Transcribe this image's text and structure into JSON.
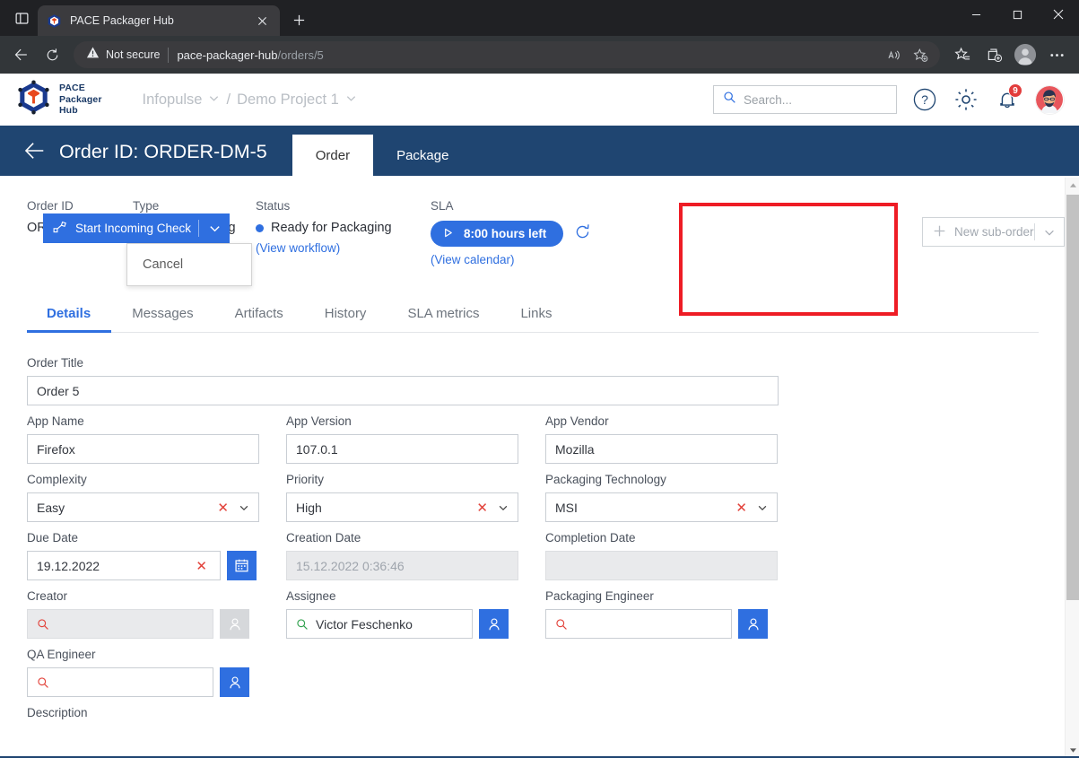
{
  "browser": {
    "tab": {
      "title": "PACE Packager Hub",
      "favicon": "pace-logo-icon",
      "close_icon": "close-icon"
    },
    "new_tab_icon": "plus-icon",
    "tab_search_icon": "tab-list-icon",
    "nav": {
      "back_icon": "back-arrow-icon",
      "reload_icon": "reload-icon"
    },
    "security": {
      "icon": "warning-icon",
      "label": "Not secure"
    },
    "url": {
      "host": "pace-packager-hub",
      "path": "/orders/5"
    },
    "omnibox_icons": [
      "read-aloud-icon",
      "add-favorite-icon"
    ],
    "toolbar_icons": [
      "favorites-icon",
      "collections-icon",
      "profile-icon",
      "settings-more-icon"
    ],
    "window_controls": {
      "minimize": "minimize-icon",
      "maximize": "maximize-icon",
      "close": "close-icon"
    }
  },
  "app": {
    "logo": {
      "icon": "pace-cube-logo",
      "line1": "PACE",
      "line2": "Packager",
      "line3": "Hub"
    },
    "breadcrumb": {
      "org": "Infopulse",
      "separator": "/",
      "project": "Demo Project 1",
      "caret_icon": "chevron-down-icon"
    },
    "search": {
      "placeholder": "Search...",
      "icon": "search-icon"
    },
    "help_icon": "help-circle-icon",
    "settings_icon": "gear-icon",
    "notifications": {
      "icon": "bell-icon",
      "count": "9"
    },
    "avatar": "user-avatar"
  },
  "order_bar": {
    "back_icon": "back-arrow-icon",
    "title": "Order ID: ORDER-DM-5",
    "tabs": [
      {
        "label": "Order",
        "active": true
      },
      {
        "label": "Package",
        "active": false
      }
    ]
  },
  "summary": {
    "order_id": {
      "label": "Order ID",
      "value": "ORDER-DM-5"
    },
    "type": {
      "label": "Type",
      "value": "App Packaging",
      "dot_color": "#2f6fe0"
    },
    "status": {
      "label": "Status",
      "value": "Ready for Packaging",
      "dot_color": "#2f6fe0",
      "link": "(View workflow)"
    },
    "sla": {
      "label": "SLA",
      "value": "8:00 hours left",
      "play_icon": "play-icon",
      "refresh_icon": "refresh-icon",
      "link": "(View calendar)"
    }
  },
  "actions": {
    "primary": {
      "label": "Start Incoming Check",
      "icon": "workflow-icon",
      "caret_icon": "chevron-down-icon",
      "color": "#2f6fe0"
    },
    "menu": [
      {
        "label": "Cancel"
      }
    ],
    "secondary": {
      "label": "New sub-order",
      "icon": "plus-icon",
      "caret_icon": "chevron-down-icon",
      "disabled": true
    },
    "highlight_color": "#ee1c25"
  },
  "detail_tabs": [
    {
      "label": "Details",
      "active": true
    },
    {
      "label": "Messages",
      "active": false
    },
    {
      "label": "Artifacts",
      "active": false
    },
    {
      "label": "History",
      "active": false
    },
    {
      "label": "SLA metrics",
      "active": false
    },
    {
      "label": "Links",
      "active": false
    }
  ],
  "form": {
    "order_title": {
      "label": "Order Title",
      "value": "Order 5"
    },
    "app_name": {
      "label": "App Name",
      "value": "Firefox"
    },
    "app_version": {
      "label": "App Version",
      "value": "107.0.1"
    },
    "app_vendor": {
      "label": "App Vendor",
      "value": "Mozilla"
    },
    "complexity": {
      "label": "Complexity",
      "value": "Easy",
      "clear_icon": "clear-x-icon",
      "caret_icon": "chevron-down-icon"
    },
    "priority": {
      "label": "Priority",
      "value": "High",
      "clear_icon": "clear-x-icon",
      "caret_icon": "chevron-down-icon"
    },
    "packaging_technology": {
      "label": "Packaging Technology",
      "value": "MSI",
      "clear_icon": "clear-x-icon",
      "caret_icon": "chevron-down-icon"
    },
    "due_date": {
      "label": "Due Date",
      "value": "19.12.2022",
      "clear_icon": "clear-x-icon",
      "picker_icon": "calendar-icon"
    },
    "creation_date": {
      "label": "Creation Date",
      "value": "15.12.2022 0:36:46",
      "disabled": true
    },
    "completion_date": {
      "label": "Completion Date",
      "value": "",
      "disabled": true
    },
    "creator": {
      "label": "Creator",
      "value": "",
      "search_icon": "search-icon",
      "picker_icon": "person-icon",
      "disabled": true
    },
    "assignee": {
      "label": "Assignee",
      "value": "Victor Feschenko",
      "search_icon": "search-icon",
      "picker_icon": "person-icon"
    },
    "packaging_engineer": {
      "label": "Packaging Engineer",
      "value": "",
      "search_icon": "search-icon",
      "picker_icon": "person-icon"
    },
    "qa_engineer": {
      "label": "QA Engineer",
      "value": "",
      "search_icon": "search-icon",
      "picker_icon": "person-icon"
    },
    "description": {
      "label": "Description"
    }
  },
  "scrollbar": {
    "up_icon": "scroll-up-icon",
    "down_icon": "scroll-down-icon"
  }
}
